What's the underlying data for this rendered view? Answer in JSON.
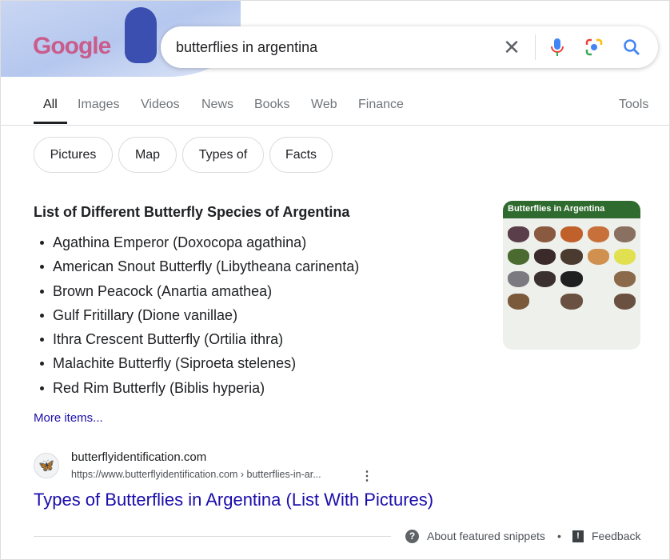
{
  "header": {
    "logo_text": "Google",
    "query": "butterflies in argentina"
  },
  "tabs": [
    {
      "label": "All"
    },
    {
      "label": "Images"
    },
    {
      "label": "Videos"
    },
    {
      "label": "News"
    },
    {
      "label": "Books"
    },
    {
      "label": "Web"
    },
    {
      "label": "Finance"
    }
  ],
  "tools_label": "Tools",
  "chips": [
    {
      "label": "Pictures"
    },
    {
      "label": "Map"
    },
    {
      "label": "Types of"
    },
    {
      "label": "Facts"
    }
  ],
  "snippet": {
    "heading": "List of Different Butterfly Species of Argentina",
    "items": [
      "Agathina Emperor (Doxocopa agathina)",
      "American Snout Butterfly (Libytheana carinenta)",
      "Brown Peacock (Anartia amathea)",
      "Gulf Fritillary (Dione vanillae)",
      "Ithra Crescent Butterfly (Ortilia ithra)",
      "Malachite Butterfly (Siproeta stelenes)",
      "Red Rim Butterfly (Biblis hyperia)"
    ],
    "more": "More items...",
    "image_title": "Butterflies in Argentina"
  },
  "result": {
    "domain": "butterflyidentification.com",
    "url": "https://www.butterflyidentification.com › butterflies-in-ar...",
    "title": "Types of Butterflies in Argentina (List With Pictures)"
  },
  "footer": {
    "about": "About featured snippets",
    "separator": "•",
    "feedback": "Feedback"
  },
  "colors": {
    "link": "#1a0dab",
    "search_blue": "#4285f4",
    "mic_red": "#ea4335"
  }
}
